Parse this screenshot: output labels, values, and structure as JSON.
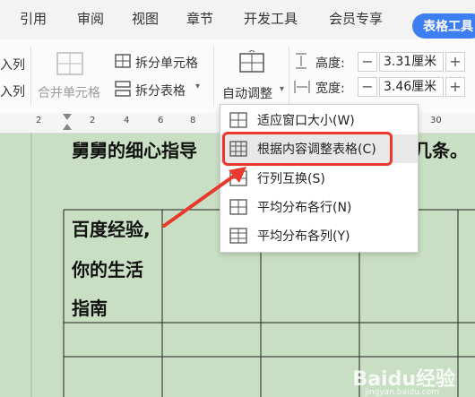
{
  "tabs": [
    "引用",
    "审阅",
    "视图",
    "章节",
    "开发工具",
    "会员专享",
    "表格工具"
  ],
  "ribbon": {
    "left_items": [
      "入列",
      "入列"
    ],
    "merge_cells": "合并单元格",
    "split_cells": "拆分单元格",
    "split_table": "拆分表格",
    "auto_adjust": "自动调整",
    "height_label": "高度:",
    "height_value": "3.31厘米",
    "width_label": "宽度:",
    "width_value": "3.46厘米",
    "minus": "−",
    "plus": "+"
  },
  "ruler": [
    "2",
    "2",
    "4",
    "6",
    "8",
    "10",
    "30"
  ],
  "document": {
    "heading": "舅舅的细心指导",
    "heading_tail": "几条。",
    "cell_lines": [
      "百度经验,",
      "你的生活",
      "指南"
    ]
  },
  "menu": {
    "items": [
      {
        "label": "适应窗口大小(W)",
        "icon": "fit-window-icon"
      },
      {
        "label": "根据内容调整表格(C)",
        "icon": "fit-content-icon"
      },
      {
        "label": "行列互换(S)",
        "icon": "swap-rows-cols-icon"
      },
      {
        "label": "平均分布各行(N)",
        "icon": "distribute-rows-icon"
      },
      {
        "label": "平均分布各列(Y)",
        "icon": "distribute-cols-icon"
      }
    ]
  },
  "watermark": {
    "brand": "Baidu经验",
    "url": "jingyan.baidu.com"
  },
  "colors": {
    "accent": "#3d7ef0",
    "highlight": "#e8392c",
    "page": "#c9dfc3"
  }
}
